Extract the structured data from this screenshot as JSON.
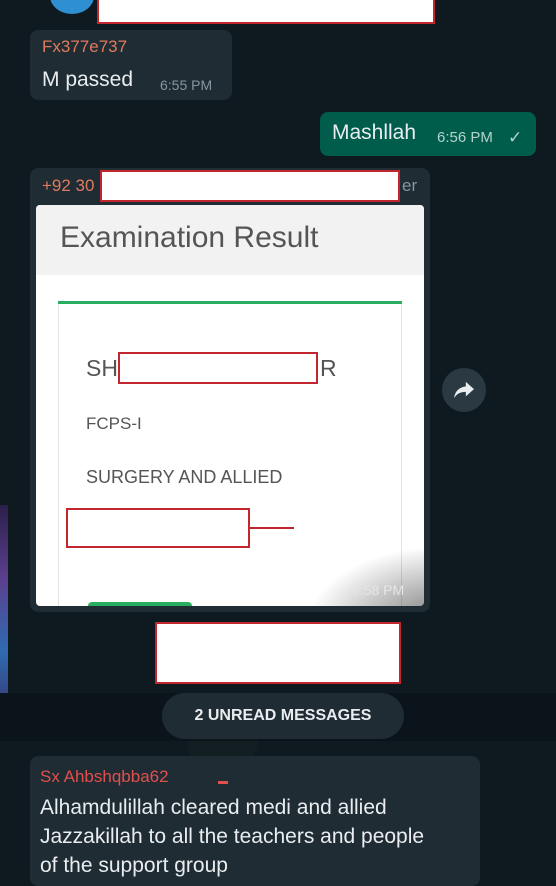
{
  "messages": [
    {
      "sender": "Fx377e737",
      "sender_color": "#e07a5f",
      "text": "M passed",
      "time": "6:55 PM"
    },
    {
      "text": "Mashllah",
      "time": "6:56 PM",
      "status": "✓"
    },
    {
      "sender_prefix": "+92 30",
      "sender_suffix": "er",
      "sender_color": "#e07a5f",
      "time": "6:58 PM"
    }
  ],
  "result_card": {
    "title": "Examination Result",
    "name_start": "SH",
    "name_end": "R",
    "exam": "FCPS-I",
    "specialty": "SURGERY AND ALLIED"
  },
  "unread_label": "2 UNREAD MESSAGES",
  "last_message": {
    "sender": "Sx Ahbshqbba62",
    "sender_color": "#e0504d",
    "lines": [
      "Alhamdulillah cleared medi and allied",
      "Jazzakillah to all the teachers and people",
      "of the support group"
    ]
  },
  "colors": {
    "bg": "#0e1a1f",
    "incoming": "#1f2c33",
    "outgoing": "#005c4b",
    "accent_green": "#27ae60"
  }
}
